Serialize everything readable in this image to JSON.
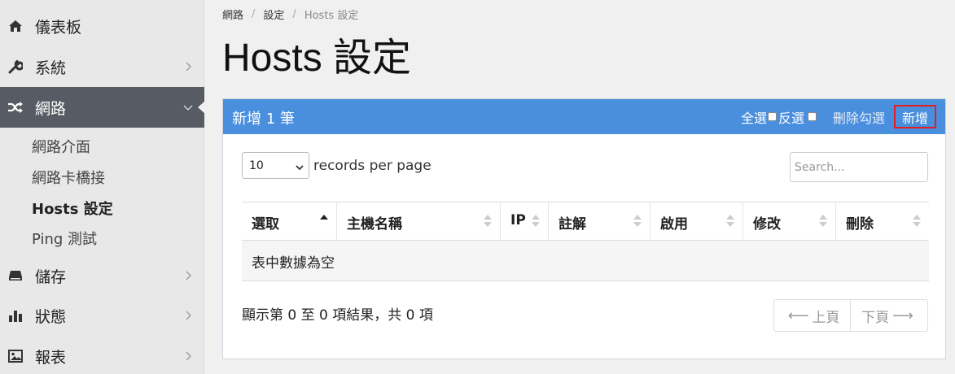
{
  "sidebar": {
    "items": [
      {
        "label": "儀表板",
        "icon": "home-icon"
      },
      {
        "label": "系統",
        "icon": "wrench-icon"
      },
      {
        "label": "網路",
        "icon": "random-icon"
      },
      {
        "label": "儲存",
        "icon": "drive-icon"
      },
      {
        "label": "狀態",
        "icon": "bar-chart-icon"
      },
      {
        "label": "報表",
        "icon": "image-icon"
      }
    ],
    "subitems": [
      "網路介面",
      "網路卡橋接",
      "Hosts 設定",
      "Ping 測試"
    ]
  },
  "breadcrumb": [
    "網路",
    "設定",
    "Hosts 設定"
  ],
  "page_title": "Hosts 設定",
  "panel": {
    "title": "新增 1 筆",
    "select_all": "全選",
    "invert": "反選",
    "delete_checked": "刪除勾選",
    "add": "新增"
  },
  "table_controls": {
    "page_length": "10",
    "records_label": "records per page",
    "search_placeholder": "Search..."
  },
  "table": {
    "columns": [
      "選取",
      "主機名稱",
      "IP",
      "註解",
      "啟用",
      "修改",
      "刪除"
    ],
    "empty": "表中數據為空"
  },
  "footer": {
    "info": "顯示第 0 至 0 項結果，共 0 項",
    "prev": "上頁",
    "next": "下頁"
  },
  "colors": {
    "panel_header": "#4a8fde",
    "sidebar_active": "#575b63",
    "add_highlight": "#e02020"
  }
}
